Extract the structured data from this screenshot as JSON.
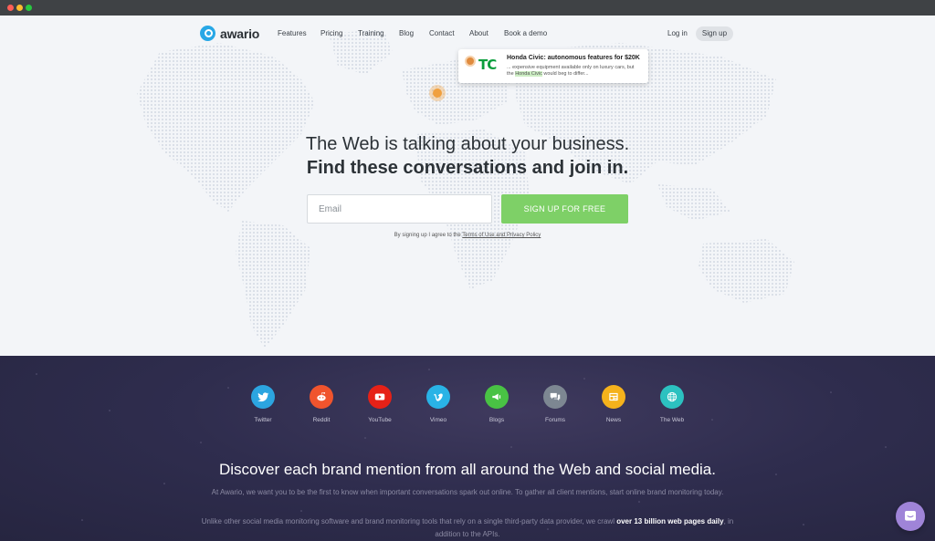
{
  "nav": {
    "logo": "awario",
    "links": [
      "Features",
      "Pricing",
      "Training",
      "Blog",
      "Contact",
      "About",
      "Book a demo"
    ],
    "login": "Log in",
    "signup": "Sign up"
  },
  "mention_card": {
    "logo_text": "TC",
    "title": "Honda Civic: autonomous features for $20K",
    "snippet_line1": "... expensive equipment available only on luxury cars, but",
    "snippet_prefix": "the ",
    "snippet_highlight": "Honda Civic",
    "snippet_suffix": " would beg to differ..."
  },
  "hero": {
    "headline_line1": "The Web is talking about your business.",
    "headline_line2": "Find these conversations and join in.",
    "email_placeholder": "Email",
    "cta": "SIGN UP FOR FREE",
    "terms_prefix": "By signing up I agree to the ",
    "terms_link": "Terms of Use and Privacy Policy"
  },
  "sources": [
    {
      "label": "Twitter",
      "icon": "twitter-icon",
      "color": "#2ca5e0"
    },
    {
      "label": "Reddit",
      "icon": "reddit-icon",
      "color": "#f0542d"
    },
    {
      "label": "YouTube",
      "icon": "youtube-icon",
      "color": "#e62117"
    },
    {
      "label": "Vimeo",
      "icon": "vimeo-icon",
      "color": "#29b3e6"
    },
    {
      "label": "Blogs",
      "icon": "megaphone-icon",
      "color": "#49c244"
    },
    {
      "label": "Forums",
      "icon": "chat-bubbles-icon",
      "color": "#7d8792"
    },
    {
      "label": "News",
      "icon": "newspaper-icon",
      "color": "#f5b21c"
    },
    {
      "label": "The Web",
      "icon": "globe-icon",
      "color": "#2cc1c0"
    }
  ],
  "discover": {
    "title": "Discover each brand mention from all around the Web and social media.",
    "p1": "At Awario, we want you to be the first to know when important conversations spark out online. To gather all client mentions, start online brand monitoring today.",
    "p2_prefix": "Unlike other social media monitoring software and brand monitoring tools that rely on a single third-party data provider, we crawl ",
    "p2_bold": "over 13 billion web pages daily",
    "p2_suffix": ", in addition to the APIs."
  },
  "colors": {
    "brand": "#27a7e6",
    "cta": "#7ed067",
    "dark_bg": "#2f2d4e",
    "chat": "#9f84d8"
  }
}
